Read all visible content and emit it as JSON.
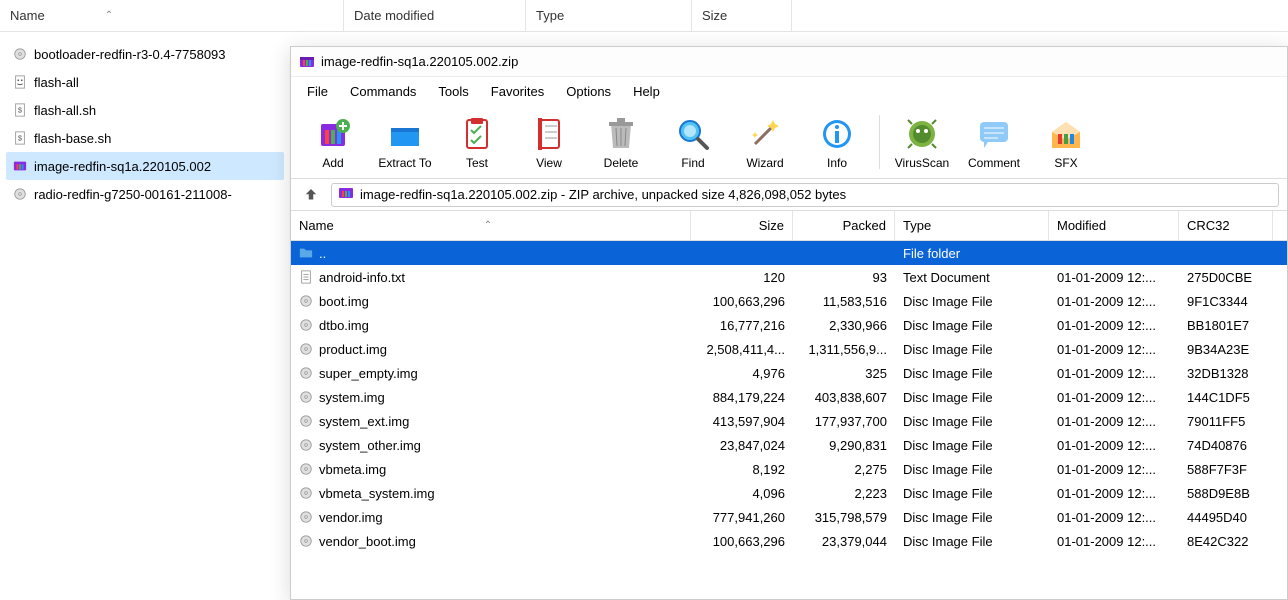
{
  "explorer": {
    "columns": {
      "name": "Name",
      "date": "Date modified",
      "type": "Type",
      "size": "Size"
    },
    "files": [
      {
        "icon": "disc",
        "name": "bootloader-redfin-r3-0.4-7758093"
      },
      {
        "icon": "bat",
        "name": "flash-all"
      },
      {
        "icon": "sh",
        "name": "flash-all.sh"
      },
      {
        "icon": "sh",
        "name": "flash-base.sh"
      },
      {
        "icon": "winrar",
        "name": "image-redfin-sq1a.220105.002",
        "selected": true
      },
      {
        "icon": "disc",
        "name": "radio-redfin-g7250-00161-211008-"
      }
    ]
  },
  "winrar": {
    "title": "image-redfin-sq1a.220105.002.zip",
    "menus": [
      "File",
      "Commands",
      "Tools",
      "Favorites",
      "Options",
      "Help"
    ],
    "tools": [
      {
        "name": "add",
        "label": "Add"
      },
      {
        "name": "extract",
        "label": "Extract To"
      },
      {
        "name": "test",
        "label": "Test"
      },
      {
        "name": "view",
        "label": "View"
      },
      {
        "name": "delete",
        "label": "Delete"
      },
      {
        "name": "find",
        "label": "Find"
      },
      {
        "name": "wizard",
        "label": "Wizard"
      },
      {
        "name": "info",
        "label": "Info"
      },
      {
        "name": "virusscan",
        "label": "VirusScan"
      },
      {
        "name": "comment",
        "label": "Comment"
      },
      {
        "name": "sfx",
        "label": "SFX"
      }
    ],
    "path": "image-redfin-sq1a.220105.002.zip - ZIP archive, unpacked size 4,826,098,052 bytes",
    "columns": {
      "name": "Name",
      "size": "Size",
      "packed": "Packed",
      "type": "Type",
      "modified": "Modified",
      "crc": "CRC32"
    },
    "rows": [
      {
        "icon": "folder",
        "name": "..",
        "size": "",
        "packed": "",
        "type": "File folder",
        "modified": "",
        "crc": "",
        "selected": true
      },
      {
        "icon": "txt",
        "name": "android-info.txt",
        "size": "120",
        "packed": "93",
        "type": "Text Document",
        "modified": "01-01-2009 12:...",
        "crc": "275D0CBE"
      },
      {
        "icon": "disc",
        "name": "boot.img",
        "size": "100,663,296",
        "packed": "11,583,516",
        "type": "Disc Image File",
        "modified": "01-01-2009 12:...",
        "crc": "9F1C3344"
      },
      {
        "icon": "disc",
        "name": "dtbo.img",
        "size": "16,777,216",
        "packed": "2,330,966",
        "type": "Disc Image File",
        "modified": "01-01-2009 12:...",
        "crc": "BB1801E7"
      },
      {
        "icon": "disc",
        "name": "product.img",
        "size": "2,508,411,4...",
        "packed": "1,311,556,9...",
        "type": "Disc Image File",
        "modified": "01-01-2009 12:...",
        "crc": "9B34A23E"
      },
      {
        "icon": "disc",
        "name": "super_empty.img",
        "size": "4,976",
        "packed": "325",
        "type": "Disc Image File",
        "modified": "01-01-2009 12:...",
        "crc": "32DB1328"
      },
      {
        "icon": "disc",
        "name": "system.img",
        "size": "884,179,224",
        "packed": "403,838,607",
        "type": "Disc Image File",
        "modified": "01-01-2009 12:...",
        "crc": "144C1DF5"
      },
      {
        "icon": "disc",
        "name": "system_ext.img",
        "size": "413,597,904",
        "packed": "177,937,700",
        "type": "Disc Image File",
        "modified": "01-01-2009 12:...",
        "crc": "79011FF5"
      },
      {
        "icon": "disc",
        "name": "system_other.img",
        "size": "23,847,024",
        "packed": "9,290,831",
        "type": "Disc Image File",
        "modified": "01-01-2009 12:...",
        "crc": "74D40876"
      },
      {
        "icon": "disc",
        "name": "vbmeta.img",
        "size": "8,192",
        "packed": "2,275",
        "type": "Disc Image File",
        "modified": "01-01-2009 12:...",
        "crc": "588F7F3F"
      },
      {
        "icon": "disc",
        "name": "vbmeta_system.img",
        "size": "4,096",
        "packed": "2,223",
        "type": "Disc Image File",
        "modified": "01-01-2009 12:...",
        "crc": "588D9E8B"
      },
      {
        "icon": "disc",
        "name": "vendor.img",
        "size": "777,941,260",
        "packed": "315,798,579",
        "type": "Disc Image File",
        "modified": "01-01-2009 12:...",
        "crc": "44495D40"
      },
      {
        "icon": "disc",
        "name": "vendor_boot.img",
        "size": "100,663,296",
        "packed": "23,379,044",
        "type": "Disc Image File",
        "modified": "01-01-2009 12:...",
        "crc": "8E42C322"
      }
    ]
  }
}
